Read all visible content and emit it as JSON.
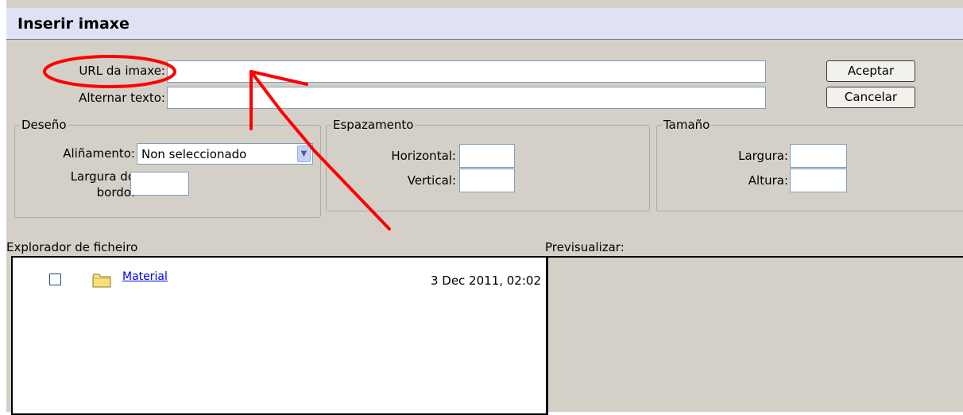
{
  "dialog": {
    "title": "Inserir imaxe",
    "url_label": "URL da imaxe:",
    "url_value": "",
    "alt_label": "Alternar texto:",
    "alt_value": "",
    "ok_button": "Aceptar",
    "cancel_button": "Cancelar"
  },
  "design": {
    "legend": "Deseño",
    "align_label": "Aliñamento:",
    "align_value": "Non seleccionado",
    "border_label_line1": "Largura do",
    "border_label_line2": "bordo:",
    "border_value": ""
  },
  "spacing": {
    "legend": "Espazamento",
    "horizontal_label": "Horizontal:",
    "vertical_label": "Vertical:"
  },
  "size": {
    "legend": "Tamaño",
    "width_label": "Largura:",
    "height_label": "Altura:"
  },
  "explorer": {
    "label": "Explorador de ficheiro",
    "items": [
      {
        "name": "Material",
        "date": "3 Dec 2011, 02:02",
        "checked": false
      }
    ]
  },
  "preview": {
    "label": "Previsualizar:"
  },
  "annotation": {
    "color": "#ff0000"
  },
  "colors": {
    "titlebar": "#e1e1f5",
    "dialog": "#d4d0c8"
  }
}
